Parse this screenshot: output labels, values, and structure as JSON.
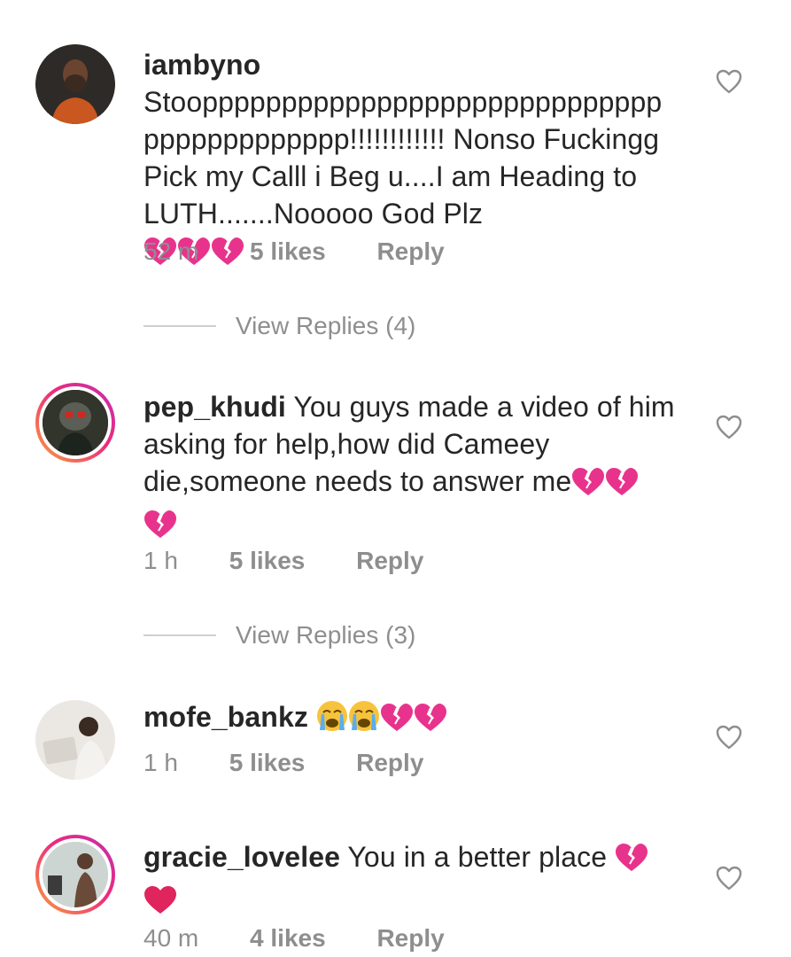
{
  "comments": [
    {
      "username": "iambyno",
      "text": "Stoopppppppppppppppppppppppppppppppppppppppppp!!!!!!!!!!!! Nonso Fuckingg Pick my Calll i Beg u....I am Heading to LUTH.......Nooooo God Plz",
      "time": "52 m",
      "likes": "5 likes",
      "reply": "Reply",
      "view_replies": "View Replies (4)"
    },
    {
      "username": "pep_khudi",
      "text": "You guys made a video of him asking for help,how did Cameey die,someone needs to answer me",
      "time": "1 h",
      "likes": "5 likes",
      "reply": "Reply",
      "view_replies": "View Replies (3)"
    },
    {
      "username": "mofe_bankz",
      "text": "",
      "time": "1 h",
      "likes": "5 likes",
      "reply": "Reply"
    },
    {
      "username": "gracie_lovelee",
      "text": "You in a better place",
      "time": "40 m",
      "likes": "4 likes",
      "reply": "Reply"
    }
  ],
  "colors": {
    "text": "#262626",
    "muted": "#8e8e8e",
    "broken_heart": "#e8338d",
    "red_heart": "#e0245e"
  }
}
